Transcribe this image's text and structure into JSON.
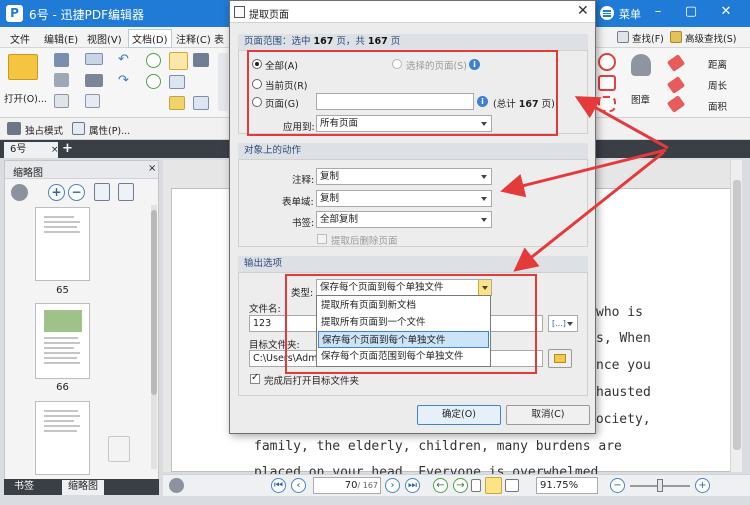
{
  "app": {
    "title": "6号 - 迅捷PDF编辑器",
    "logo_letter": "P",
    "menu_label": "菜单",
    "window_controls": [
      "–",
      "▢",
      "✕"
    ]
  },
  "menubar": [
    "文件",
    "编辑(E)",
    "视图(V)",
    "文档(D)",
    "注释(C)",
    "表"
  ],
  "ribbon": {
    "open_label": "打开(O)...",
    "right_tools": {
      "find": "查找(F)",
      "advanced_find": "高级查找(S)",
      "stamp": "图章",
      "distance": "距离",
      "perimeter": "周长",
      "area": "面积"
    },
    "row2": {
      "exclusive_mode": "独占模式",
      "properties": "属性(P)..."
    }
  },
  "doc_tab": {
    "name": "6号",
    "close": "×",
    "add": "+"
  },
  "thumbnails": {
    "title": "缩略图",
    "close": "×",
    "page_numbers": [
      "65",
      "66"
    ],
    "bottom_tabs": [
      "书签",
      "缩略图"
    ]
  },
  "document": {
    "lines": [
      {
        "text": "who  is"
      },
      {
        "text": "s,  When"
      },
      {
        "text": "nce  you"
      },
      {
        "text": "hausted"
      },
      {
        "text": "society,"
      },
      {
        "text": "family,   the  elderly,  children,   many  burdens  are"
      },
      {
        "text": "placed   on  your  head.   Everyone   is   overwhelmed"
      }
    ]
  },
  "statusbar": {
    "page_current": "70",
    "page_total": "/ 167",
    "zoom": "91.75%"
  },
  "dialog": {
    "title": "提取页面",
    "close": "✕",
    "page_range": {
      "header_prefix": "页面范围：选中 ",
      "selected_count": "167",
      "header_mid": " 页，共 ",
      "total_count": "167",
      "header_suffix": " 页",
      "options": {
        "all": "全部(A)",
        "current": "当前页(R)",
        "pages": "页面(G)",
        "selected": "选择的页面(S)"
      },
      "pages_input_value": "",
      "total_note_prefix": "(总计 ",
      "total_note_count": "167",
      "total_note_suffix": " 页)",
      "apply_to_label": "应用到:",
      "apply_to_value": "所有页面"
    },
    "object_actions": {
      "header": "对象上的动作",
      "annotations_label": "注释:",
      "annotations_value": "复制",
      "form_fields_label": "表单域:",
      "form_fields_value": "复制",
      "bookmarks_label": "书签:",
      "bookmarks_value": "全部复制",
      "delete_after_label": "提取后删除页面"
    },
    "output": {
      "header": "输出选项",
      "type_label": "类型:",
      "type_value": "保存每个页面到每个单独文件",
      "type_options": [
        "提取所有页面到新文档",
        "提取所有页面到一个文件",
        "保存每个页面到每个单独文件",
        "保存每个页面范围到每个单独文件"
      ],
      "filename_label": "文件名:",
      "filename_value": "123",
      "macro_button": "[...]",
      "folder_label": "目标文件夹:",
      "folder_value": "C:\\Users\\Admi",
      "open_after_label": "完成后打开目标文件夹"
    },
    "ok_label": "确定(O)",
    "cancel_label": "取消(C)"
  },
  "colors": {
    "titlebar": "#1f7bd6",
    "annotation_red": "#e53a3a",
    "selection_blue": "#cce4f7"
  }
}
